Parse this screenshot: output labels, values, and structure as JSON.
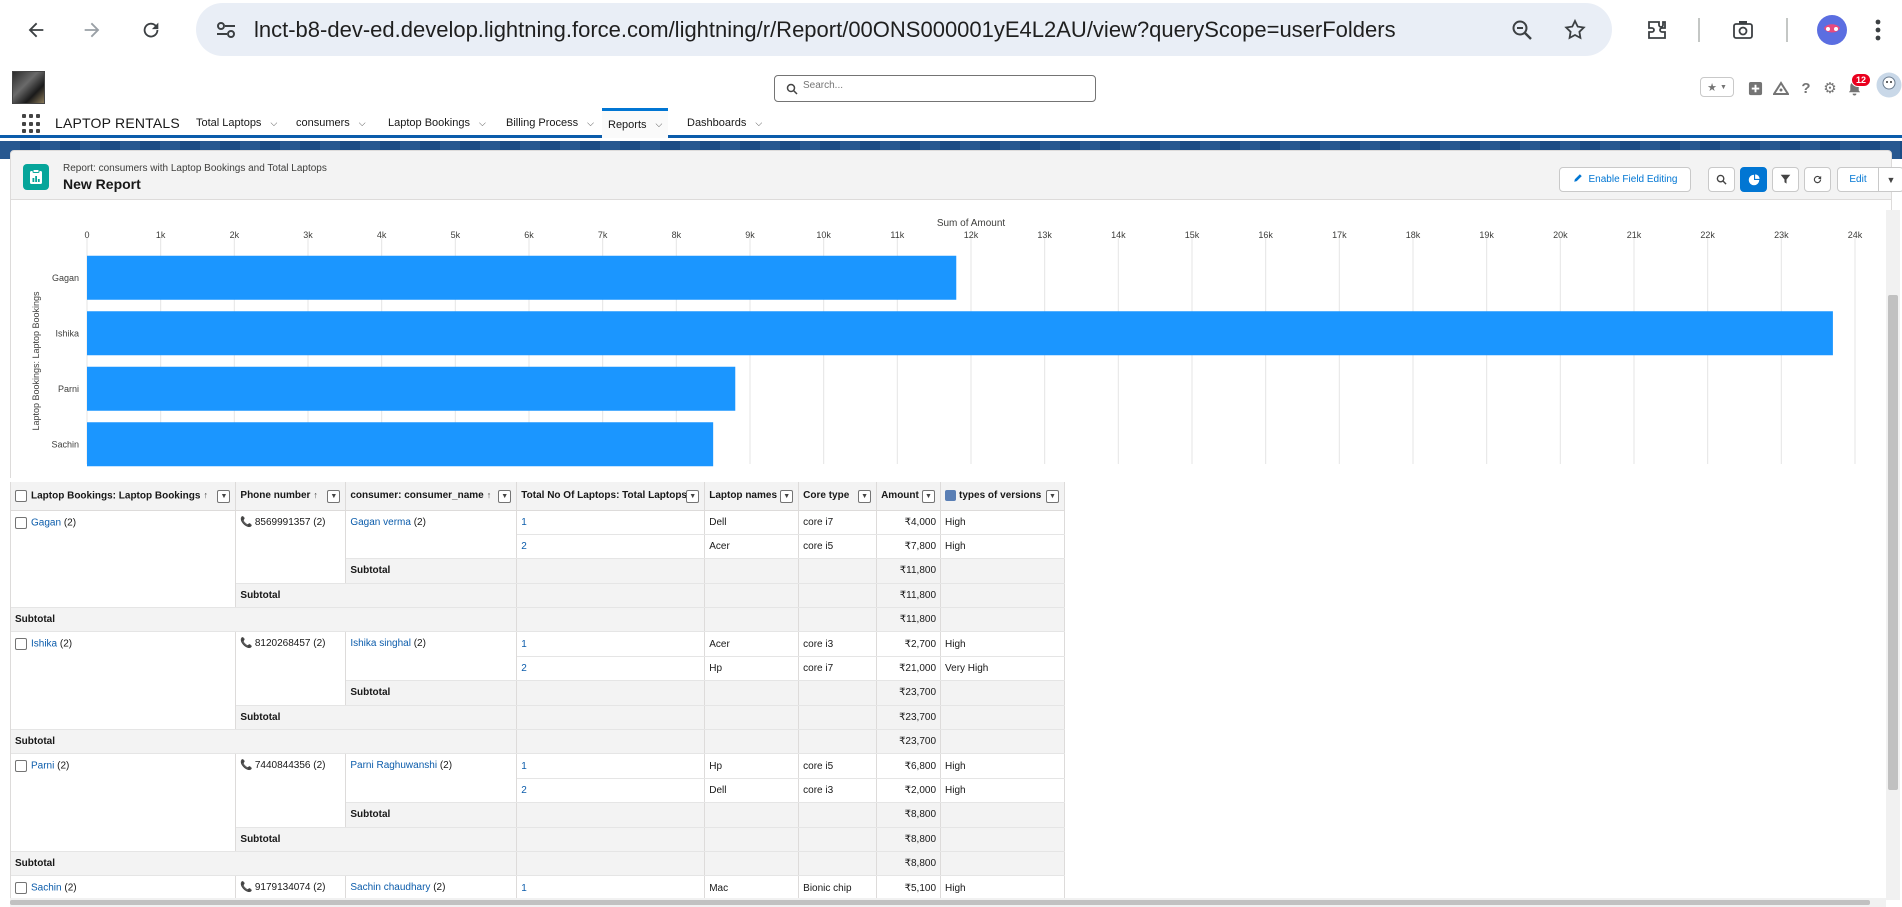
{
  "browser": {
    "url": "lnct-b8-dev-ed.develop.lightning.force.com/lightning/r/Report/00ONS000001yE4L2AU/view?queryScope=userFolders"
  },
  "global_header": {
    "search_placeholder": "Search...",
    "notification_count": "12"
  },
  "app_nav": {
    "app_name": "LAPTOP RENTALS",
    "tabs": [
      {
        "label": "Total Laptops"
      },
      {
        "label": "consumers"
      },
      {
        "label": "Laptop Bookings"
      },
      {
        "label": "Billing Process"
      },
      {
        "label": "Reports",
        "active": true
      },
      {
        "label": "Dashboards"
      }
    ]
  },
  "report": {
    "subtitle": "Report: consumers with Laptop Bookings and Total Laptops",
    "title": "New Report",
    "enable_field_editing_label": "Enable Field Editing",
    "edit_label": "Edit"
  },
  "chart_data": {
    "type": "bar",
    "orientation": "horizontal",
    "title": "Sum of Amount",
    "ylabel": "Laptop Bookings: Laptop Bookings",
    "categories": [
      "Gagan",
      "Ishika",
      "Parni",
      "Sachin"
    ],
    "values": [
      11800,
      23700,
      8800,
      8500
    ],
    "xlim": [
      0,
      24000
    ],
    "xticks": [
      "0",
      "1k",
      "2k",
      "3k",
      "4k",
      "5k",
      "6k",
      "7k",
      "8k",
      "9k",
      "10k",
      "11k",
      "12k",
      "13k",
      "14k",
      "15k",
      "16k",
      "17k",
      "18k",
      "19k",
      "20k",
      "21k",
      "22k",
      "23k",
      "24k"
    ],
    "bar_color": "#1b96ff",
    "grid": true
  },
  "table": {
    "columns": [
      "Laptop Bookings: Laptop Bookings",
      "Phone number",
      "consumer: consumer_name",
      "Total No Of Laptops: Total Laptops",
      "Laptop names",
      "Core type",
      "Amount",
      "types of versions"
    ],
    "subtotal_label": "Subtotal",
    "groups": [
      {
        "booking": "Gagan",
        "booking_count": "(2)",
        "phone": "8569991357",
        "phone_count": "(2)",
        "consumer": "Gagan verma",
        "consumer_count": "(2)",
        "rows": [
          {
            "total": "1",
            "name": "Dell",
            "core": "core i7",
            "amount": "₹4,000",
            "version": "High"
          },
          {
            "total": "2",
            "name": "Acer",
            "core": "core i5",
            "amount": "₹7,800",
            "version": "High"
          }
        ],
        "subtotal": "₹11,800"
      },
      {
        "booking": "Ishika",
        "booking_count": "(2)",
        "phone": "8120268457",
        "phone_count": "(2)",
        "consumer": "Ishika singhal",
        "consumer_count": "(2)",
        "rows": [
          {
            "total": "1",
            "name": "Acer",
            "core": "core i3",
            "amount": "₹2,700",
            "version": "High"
          },
          {
            "total": "2",
            "name": "Hp",
            "core": "core i7",
            "amount": "₹21,000",
            "version": "Very High"
          }
        ],
        "subtotal": "₹23,700"
      },
      {
        "booking": "Parni",
        "booking_count": "(2)",
        "phone": "7440844356",
        "phone_count": "(2)",
        "consumer": "Parni Raghuwanshi",
        "consumer_count": "(2)",
        "rows": [
          {
            "total": "1",
            "name": "Hp",
            "core": "core i5",
            "amount": "₹6,800",
            "version": "High"
          },
          {
            "total": "2",
            "name": "Dell",
            "core": "core i3",
            "amount": "₹2,000",
            "version": "High"
          }
        ],
        "subtotal": "₹8,800"
      },
      {
        "booking": "Sachin",
        "booking_count": "(2)",
        "phone": "9179134074",
        "phone_count": "(2)",
        "consumer": "Sachin chaudhary",
        "consumer_count": "(2)",
        "rows": [
          {
            "total": "1",
            "name": "Mac",
            "core": "Bionic chip",
            "amount": "₹5,100",
            "version": "High"
          }
        ]
      }
    ]
  }
}
